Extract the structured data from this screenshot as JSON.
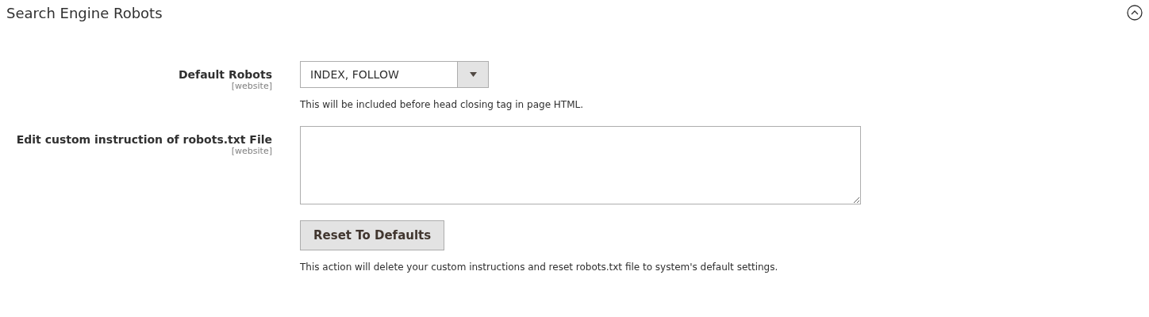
{
  "section": {
    "title": "Search Engine Robots",
    "expanded": true
  },
  "rows": [
    {
      "kind": "select",
      "label": "Default Robots",
      "scope": "[website]",
      "value": "INDEX, FOLLOW",
      "note": "This will be included before head closing tag in page HTML."
    },
    {
      "kind": "textarea",
      "label": "Edit custom instruction of robots.txt File",
      "scope": "[website]"
    },
    {
      "kind": "button",
      "button_label": "Reset To Defaults",
      "note": "This action will delete your custom instructions and reset robots.txt file to system's default settings."
    }
  ]
}
